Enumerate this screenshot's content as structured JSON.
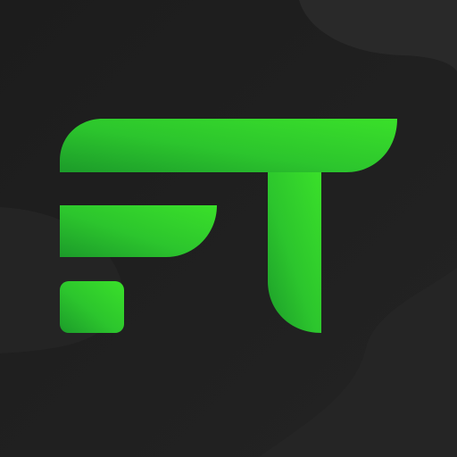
{
  "app_icon": {
    "monogram": "FT",
    "brand_color": "#33d62b",
    "brand_color_dark": "#1c9b2a",
    "background_color": "#1f1f1f",
    "background_wave_color": "#2a2a2a"
  }
}
